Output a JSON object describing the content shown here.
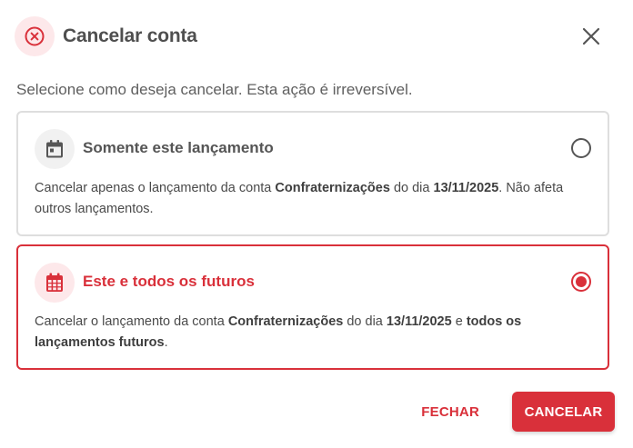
{
  "dialog": {
    "title": "Cancelar conta",
    "subtitle": "Selecione como deseja cancelar. Esta ação é irreversível.",
    "header_icon": "cancel-circle-icon",
    "close_icon": "close-icon"
  },
  "options": [
    {
      "title": "Somente este lançamento",
      "icon": "calendar-icon",
      "selected": false,
      "desc": {
        "p1": "Cancelar apenas o lançamento da conta ",
        "account": "Confraternizações",
        "p2": " do dia ",
        "date": "13/11/2025",
        "p3": ". Não afeta outros lançamentos."
      }
    },
    {
      "title": "Este e todos os futuros",
      "icon": "calendar-grid-icon",
      "selected": true,
      "desc": {
        "p1": "Cancelar o lançamento da conta ",
        "account": "Confraternizações",
        "p2": " do dia ",
        "date": "13/11/2025",
        "p3": " e ",
        "emph": "todos os lançamentos futuros",
        "p4": "."
      }
    }
  ],
  "footer": {
    "close_label": "FECHAR",
    "cancel_label": "CANCELAR"
  },
  "colors": {
    "accent": "#d9303a",
    "accent_light": "#fde8ea",
    "text_dark": "#4f4f4f",
    "border": "#dedede"
  }
}
